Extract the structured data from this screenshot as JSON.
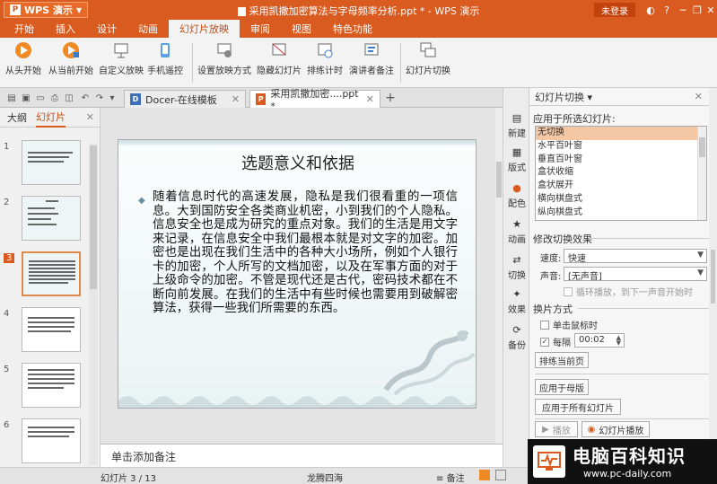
{
  "app": {
    "logo": "WPS 演示",
    "title": "采用凯撒加密算法与字母频率分析.ppt * - WPS 演示",
    "login": "未登录"
  },
  "menu": [
    "开始",
    "插入",
    "设计",
    "动画",
    "幻灯片放映",
    "审阅",
    "视图",
    "特色功能"
  ],
  "menu_active": "幻灯片放映",
  "ribbon": [
    {
      "label": "从头开始",
      "icon": "play-icon"
    },
    {
      "label": "从当前开始",
      "icon": "play-current-icon"
    },
    {
      "label": "自定义放映",
      "icon": "custom-show-icon"
    },
    {
      "label": "手机遥控",
      "icon": "phone-remote-icon"
    },
    {
      "label": "设置放映方式",
      "icon": "setup-show-icon"
    },
    {
      "label": "隐藏幻灯片",
      "icon": "hide-slide-icon"
    },
    {
      "label": "排练计时",
      "icon": "rehearse-timing-icon"
    },
    {
      "label": "演讲者备注",
      "icon": "speaker-notes-icon"
    },
    {
      "label": "幻灯片切换",
      "icon": "slide-transition-icon"
    }
  ],
  "tabs": [
    {
      "label": "Docer-在线模板",
      "icon": "D"
    },
    {
      "label": "采用凯撒加密....ppt *",
      "icon": "P"
    }
  ],
  "left_panel": {
    "tabs": [
      "大纲",
      "幻灯片"
    ],
    "active_tab": "幻灯片",
    "slide_numbers": [
      "1",
      "2",
      "3",
      "4",
      "5",
      "6"
    ],
    "selected": "3"
  },
  "slide": {
    "title": "选题意义和依据",
    "body": "随着信息时代的高速发展，隐私是我们很看重的一项信息。大到国防安全各类商业机密，小到我们的个人隐私。信息安全也是成为研究的重点对象。我们的生活是用文字来记录，在信息安全中我们最根本就是对文字的加密。加密也是出现在我们生活中的各种大小场所，例如个人银行卡的加密，个人所写的文档加密，以及在军事方面的对于上级命令的加密。不管是现代还是古代，密码技术都在不断向前发展。在我们的生活中有些时候也需要用到破解密算法，获得一些我们所需要的东西。"
  },
  "notes_placeholder": "单击添加备注",
  "right_sidebar": [
    "新建",
    "版式",
    "配色",
    "动画",
    "切换",
    "效果",
    "备份"
  ],
  "task_pane": {
    "title": "幻灯片切换 ▾",
    "apply_label": "应用于所选幻灯片:",
    "transitions": [
      "无切换",
      "水平百叶窗",
      "垂直百叶窗",
      "盒状收缩",
      "盒状展开",
      "横向棋盘式",
      "纵向棋盘式"
    ],
    "selected_transition": "无切换",
    "modify_label": "修改切换效果",
    "speed_label": "速度:",
    "speed_value": "快速",
    "sound_label": "声音:",
    "sound_value": "[无声音]",
    "loop_label": "循环播放，到下一声音开始时",
    "advance_label": "换片方式",
    "on_click_label": "单击鼠标时",
    "every_label": "每隔",
    "every_value": "00:02",
    "rehearse_btn": "排练当前页",
    "apply_master_btn": "应用于母版",
    "apply_all_btn": "应用于所有幻灯片",
    "play_btn": "播放",
    "slideshow_btn": "幻灯片播放"
  },
  "status": {
    "slide_info": "幻灯片 3 / 13",
    "theme": "龙腾四海",
    "notes": "备注"
  },
  "watermark": {
    "main": "电脑百科知识",
    "url": "www.pc-daily.com"
  },
  "colors": {
    "accent": "#d95b1f",
    "selection": "#f3c7a4"
  }
}
